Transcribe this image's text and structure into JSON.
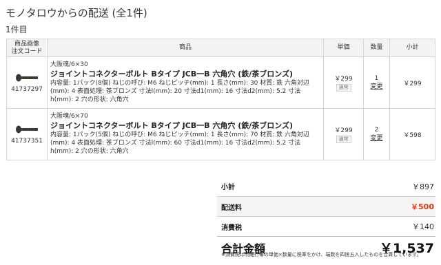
{
  "header": {
    "title": "モノタロウからの配送 (全1件)",
    "count": "1件目"
  },
  "table": {
    "headers": {
      "image_code_line1": "商品画像",
      "image_code_line2": "注文コード",
      "name": "商品",
      "price": "単価",
      "qty": "数量",
      "subtotal": "小計"
    },
    "items": [
      {
        "code": "41737297",
        "brand": "大阪魂/6×30",
        "name": "ジョイントコネクターボルト Bタイプ JCB一B 六角穴 (鉄/茶ブロンズ)",
        "spec": "内容量: 1パック(8個) ねじの呼び: M6 ねじピッチ(mm): 1 長さ(mm): 30 材質: 鉄 六角対辺(mm): 4 表面処理: 茶ブロンズ 寸法l(mm): 20 寸法d1(mm): 16 寸法d2(mm): 5.2 寸法h(mm): 2 穴の形状: 六角穴",
        "price": "￥299",
        "price_badge": "通常",
        "qty": "1",
        "change_label": "変更",
        "subtotal": "￥299"
      },
      {
        "code": "41737351",
        "brand": "大阪魂/6×70",
        "name": "ジョイントコネクターボルト Bタイプ JCB一B 六角穴 (鉄/茶ブロンズ)",
        "spec": "内容量: 1パック(5個) ねじの呼び: M6 ねじピッチ(mm): 1 長さ(mm): 70 材質: 鉄 六角対辺(mm): 4 表面処理: 茶ブロンズ 寸法l(mm): 60 寸法d1(mm): 16 寸法d2(mm): 5.2 寸法h(mm): 2 穴の形状: 六角穴",
        "price": "￥299",
        "price_badge": "通常",
        "qty": "2",
        "change_label": "変更",
        "subtotal": "￥598"
      }
    ]
  },
  "summary": {
    "subtotal_label": "小計",
    "subtotal_value": "￥897",
    "shipping_label": "配送料",
    "shipping_value": "￥500",
    "tax_label": "消費税",
    "tax_value": "￥140",
    "total_label": "合計金額",
    "total_value": "￥1,537",
    "note": "※消費税は明細行毎の単価×数量に税率をかけ、端数を四捨五入したものを合算しています。"
  },
  "colors": {
    "shipping_accent": "#e8380d",
    "header_bg": "#f3f3f3",
    "border": "#d6d6d6"
  }
}
